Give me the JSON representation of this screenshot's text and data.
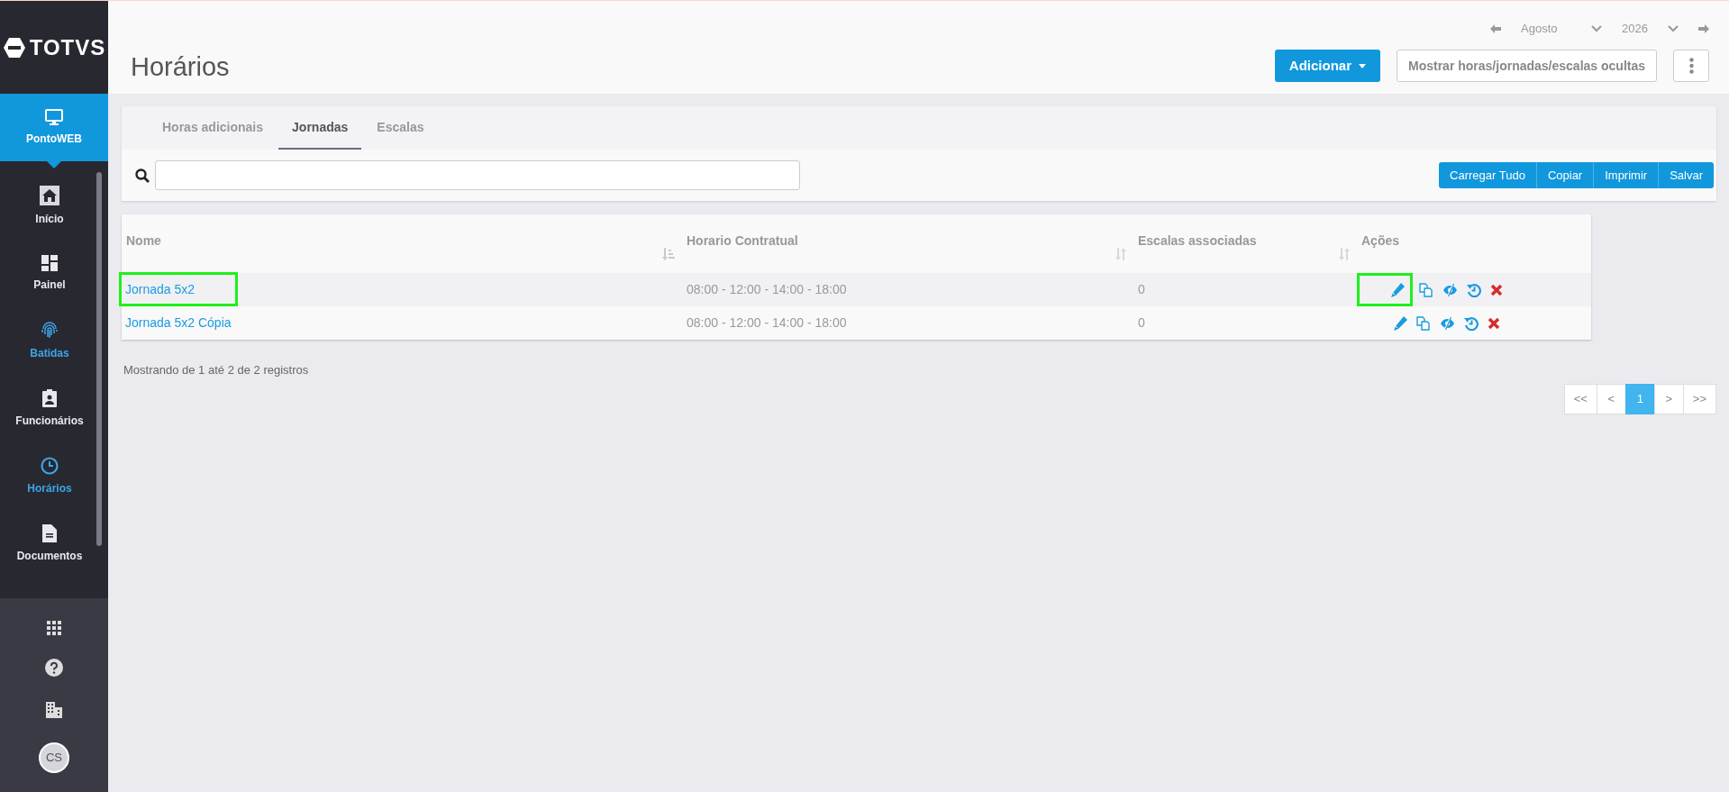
{
  "sidebar": {
    "logo": "TOTVS",
    "app": {
      "label": "PontoWEB",
      "selected": true
    },
    "items": [
      {
        "kind": "home",
        "label": "Início",
        "selected": false
      },
      {
        "kind": "dashboard",
        "label": "Painel",
        "selected": false
      },
      {
        "kind": "fingerprint",
        "label": "Batidas",
        "selected": true
      },
      {
        "kind": "badge",
        "label": "Funcionários",
        "selected": false
      },
      {
        "kind": "clock",
        "label": "Horários",
        "selected": true
      },
      {
        "kind": "document",
        "label": "Documentos",
        "selected": false
      }
    ],
    "avatar": "CS"
  },
  "header": {
    "title": "Horários",
    "month": "Agosto",
    "year": "2026",
    "add_button": "Adicionar",
    "toggle_button": "Mostrar horas/jornadas/escalas ocultas"
  },
  "tabs": [
    {
      "label": "Horas adicionais",
      "selected": false
    },
    {
      "label": "Jornadas",
      "selected": true
    },
    {
      "label": "Escalas",
      "selected": false
    }
  ],
  "toolbar": {
    "buttons": [
      "Carregar Tudo",
      "Copiar",
      "Imprimir",
      "Salvar"
    ]
  },
  "table": {
    "columns": [
      {
        "label": "Nome",
        "kind": "sorted"
      },
      {
        "label": "Horario Contratual",
        "kind": "sortable"
      },
      {
        "label": "Escalas associadas",
        "kind": "sortable"
      },
      {
        "label": "Ações",
        "kind": "plain"
      }
    ],
    "rows": [
      {
        "name": "Jornada 5x2",
        "name_highlighted": true,
        "schedule": "08:00 - 12:00 - 14:00 - 18:00",
        "scales": "0",
        "actions": [
          {
            "kind": "edit",
            "highlighted": true
          },
          {
            "kind": "copy",
            "highlighted": false
          },
          {
            "kind": "hide",
            "highlighted": false
          },
          {
            "kind": "restore",
            "highlighted": false
          },
          {
            "kind": "delete",
            "highlighted": false
          }
        ]
      },
      {
        "name": "Jornada 5x2 Cópia",
        "name_highlighted": false,
        "schedule": "08:00 - 12:00 - 14:00 - 18:00",
        "scales": "0",
        "actions": [
          {
            "kind": "edit",
            "highlighted": false
          },
          {
            "kind": "copy",
            "highlighted": false
          },
          {
            "kind": "hide",
            "highlighted": false
          },
          {
            "kind": "restore",
            "highlighted": false
          },
          {
            "kind": "delete",
            "highlighted": false
          }
        ]
      }
    ],
    "summary": "Mostrando de 1 até 2 de 2 registros"
  },
  "pagination": [
    {
      "label": "<<",
      "selected": false
    },
    {
      "label": "<",
      "selected": false
    },
    {
      "label": "1",
      "selected": true
    },
    {
      "label": ">",
      "selected": false
    },
    {
      "label": ">>",
      "selected": false
    }
  ]
}
